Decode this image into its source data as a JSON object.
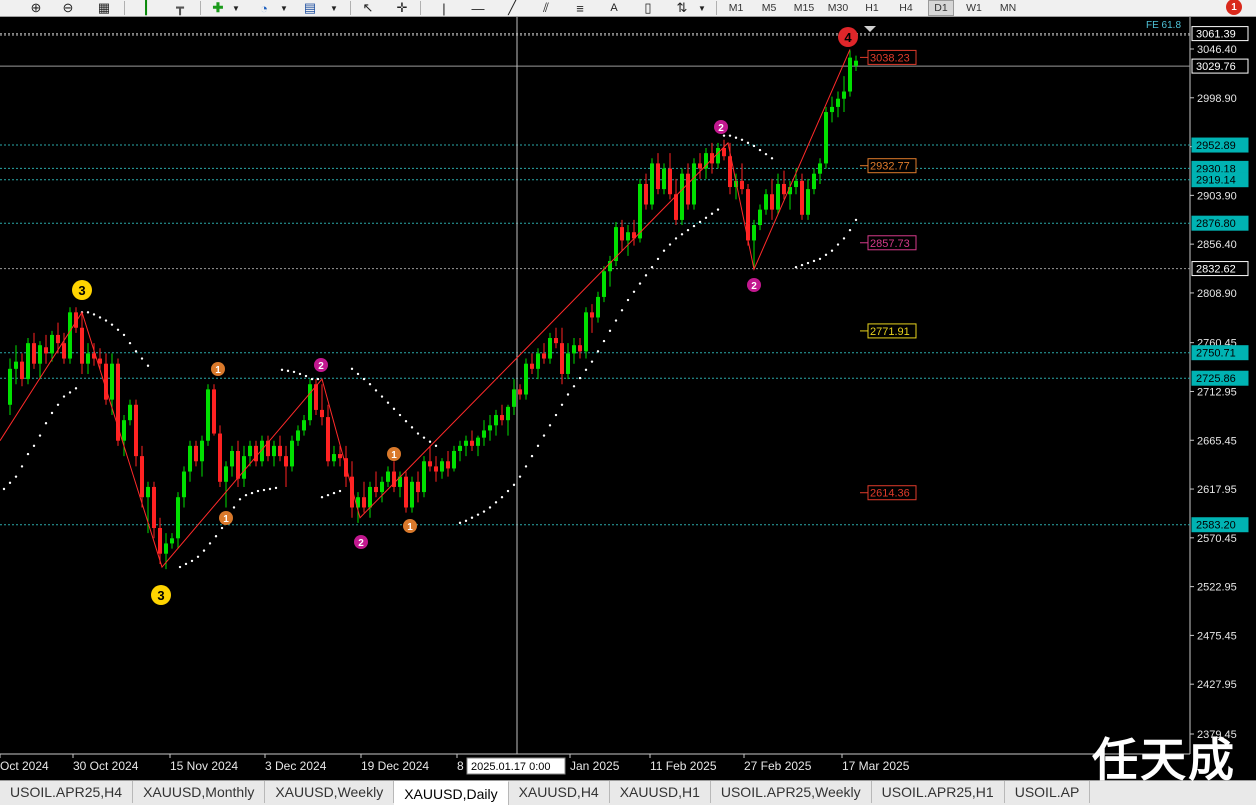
{
  "toolbar": {
    "icons": [
      "zoom-in-icon",
      "zoom-out-icon",
      "tile-windows-icon",
      "chart-bars-icon",
      "chart-shift-icon",
      "add-indicator-icon",
      "period-clock-icon",
      "templates-icon",
      "cursor-icon",
      "crosshair-icon",
      "vertical-line-icon",
      "horizontal-line-icon",
      "trendline-icon",
      "equidistant-channel-icon",
      "fibonacci-icon",
      "text-icon",
      "text-label-icon",
      "arrows-icon"
    ],
    "text_tool": "A",
    "timeframes": [
      "M1",
      "M5",
      "M15",
      "M30",
      "H1",
      "H4",
      "D1",
      "W1",
      "MN"
    ],
    "active_timeframe": "D1",
    "alert_count": "1"
  },
  "chart": {
    "symbol": "XAUUSD",
    "period": "Daily",
    "indicator_label": "FE 61.8",
    "crosshair_time": "2025.01.17 0:00",
    "price_axis_ticks": [
      "3046.40",
      "2998.90",
      "2951.35",
      "2903.90",
      "2856.40",
      "2808.90",
      "2760.45",
      "2712.95",
      "2665.45",
      "2617.95",
      "2570.45",
      "2522.95",
      "2475.45",
      "2427.95",
      "2379.45"
    ],
    "price_labels": [
      {
        "value": "3061.39",
        "color": "#ffffff",
        "border": "#ffffff"
      },
      {
        "value": "3029.76",
        "color": "#ffffff",
        "border": "#ffffff"
      },
      {
        "value": "2952.89",
        "color": "#00b3b3",
        "border": "#00b3b3"
      },
      {
        "value": "2930.18",
        "color": "#00b3b3",
        "border": "#00b3b3"
      },
      {
        "value": "2919.14",
        "color": "#00b3b3",
        "border": "#00b3b3"
      },
      {
        "value": "2876.80",
        "color": "#00b3b3",
        "border": "#00b3b3"
      },
      {
        "value": "2832.62",
        "color": "#ffffff",
        "border": "#ffffff"
      },
      {
        "value": "2750.71",
        "color": "#00b3b3",
        "border": "#00b3b3"
      },
      {
        "value": "2725.86",
        "color": "#00b3b3",
        "border": "#00b3b3"
      },
      {
        "value": "2583.20",
        "color": "#00b3b3",
        "border": "#00b3b3"
      }
    ],
    "fib_levels": [
      {
        "value": "3038.23",
        "color": "#e03b2b"
      },
      {
        "value": "2932.77",
        "color": "#e07b2b"
      },
      {
        "value": "2857.73",
        "color": "#d63a8a"
      },
      {
        "value": "2771.91",
        "color": "#e8d31e"
      },
      {
        "value": "2614.36",
        "color": "#e03b2b"
      }
    ],
    "date_axis": [
      "Oct 2024",
      "30 Oct 2024",
      "15 Nov 2024",
      "3 Dec 2024",
      "19 Dec 2024",
      "8",
      "Jan 2025",
      "11 Feb 2025",
      "27 Feb 2025",
      "17 Mar 2025"
    ],
    "wave_labels": [
      {
        "text": "3",
        "color": "#ffd400",
        "text_color": "#000"
      },
      {
        "text": "3",
        "color": "#ffd400",
        "text_color": "#000"
      },
      {
        "text": "4",
        "color": "#e0262a",
        "text_color": "#000"
      },
      {
        "text": "2",
        "color": "#c2188f",
        "text_color": "#fff"
      },
      {
        "text": "2",
        "color": "#c2188f",
        "text_color": "#fff"
      },
      {
        "text": "2",
        "color": "#c2188f",
        "text_color": "#fff"
      },
      {
        "text": "2",
        "color": "#c2188f",
        "text_color": "#fff"
      },
      {
        "text": "1",
        "color": "#d9792b",
        "text_color": "#fff"
      },
      {
        "text": "1",
        "color": "#d9792b",
        "text_color": "#fff"
      },
      {
        "text": "1",
        "color": "#d9792b",
        "text_color": "#fff"
      },
      {
        "text": "1",
        "color": "#d9792b",
        "text_color": "#fff"
      }
    ],
    "colors": {
      "bull": "#00e000",
      "bear": "#ff2222",
      "zigzag": "#ff2a2a",
      "sar": "#ffffff",
      "grid_line": "#2aa7a7"
    }
  },
  "tabs": [
    {
      "label": "USOIL.APR25,H4",
      "active": false
    },
    {
      "label": "XAUUSD,Monthly",
      "active": false
    },
    {
      "label": "XAUUSD,Weekly",
      "active": false
    },
    {
      "label": "XAUUSD,Daily",
      "active": true
    },
    {
      "label": "XAUUSD,H4",
      "active": false
    },
    {
      "label": "XAUUSD,H1",
      "active": false
    },
    {
      "label": "USOIL.APR25,Weekly",
      "active": false
    },
    {
      "label": "USOIL.APR25,H1",
      "active": false
    },
    {
      "label": "USOIL.AP",
      "active": false
    }
  ],
  "watermark": "任天成"
}
